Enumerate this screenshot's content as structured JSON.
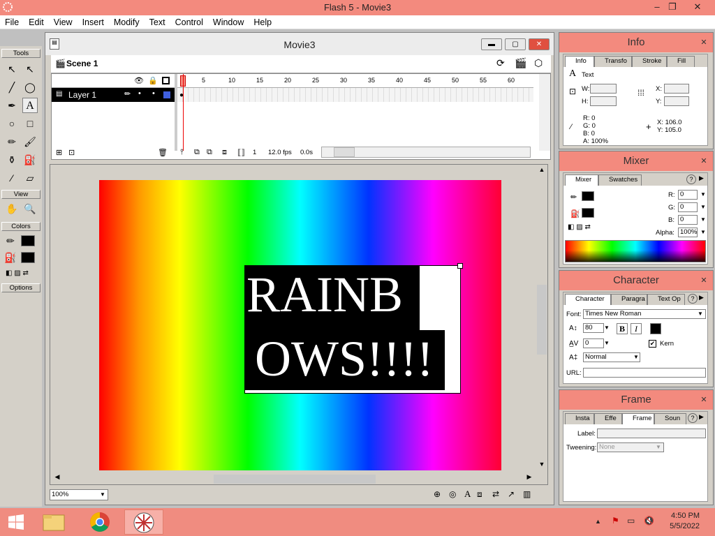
{
  "window": {
    "title": "Flash 5 - Movie3",
    "min": "–",
    "max": "❐",
    "close": "✕"
  },
  "menu": [
    "File",
    "Edit",
    "View",
    "Insert",
    "Modify",
    "Text",
    "Control",
    "Window",
    "Help"
  ],
  "tools": {
    "header": "Tools",
    "view_header": "View",
    "colors_header": "Colors",
    "options_header": "Options"
  },
  "movie": {
    "title": "Movie3",
    "scene": "Scene 1",
    "layer": "Layer 1",
    "frame_ticks": [
      "5",
      "10",
      "15",
      "20",
      "25",
      "30",
      "35",
      "40",
      "45",
      "50",
      "55",
      "60"
    ],
    "current_frame": "1",
    "fps": "12.0 fps",
    "time": "0.0s",
    "zoom": "100%",
    "text_line1": "RAINB",
    "text_line2": "OWS!!!!"
  },
  "info": {
    "title": "Info",
    "tabs": [
      "Info",
      "Transfo",
      "Stroke",
      "Fill"
    ],
    "kind": "Text",
    "w_label": "W:",
    "h_label": "H:",
    "x_label": "X:",
    "y_label": "Y:",
    "r": "R: 0",
    "g": "G: 0",
    "b": "B: 0",
    "a": "A: 100%",
    "cx": "X: 106.0",
    "cy": "Y: 105.0"
  },
  "mixer": {
    "title": "Mixer",
    "tabs": [
      "Mixer",
      "Swatches"
    ],
    "r_label": "R:",
    "g_label": "G:",
    "b_label": "B:",
    "alpha_label": "Alpha:",
    "r": "0",
    "g": "0",
    "b": "0",
    "alpha": "100%",
    "help": "?"
  },
  "character": {
    "title": "Character",
    "tabs": [
      "Character",
      "Paragra",
      "Text Op"
    ],
    "font_label": "Font:",
    "font": "Times New Roman",
    "size": "80",
    "tracking": "0",
    "bold": "B",
    "italic": "I",
    "kern_label": "Kern",
    "baseline": "Normal",
    "url_label": "URL:"
  },
  "frame": {
    "title": "Frame",
    "tabs": [
      "Insta",
      "Effe",
      "Frame",
      "Soun"
    ],
    "label_label": "Label:",
    "tweening_label": "Tweening:",
    "tweening": "None"
  },
  "taskbar": {
    "time": "4:50 PM",
    "date": "5/5/2022"
  },
  "colors": {
    "accent": "#f38a7e"
  }
}
